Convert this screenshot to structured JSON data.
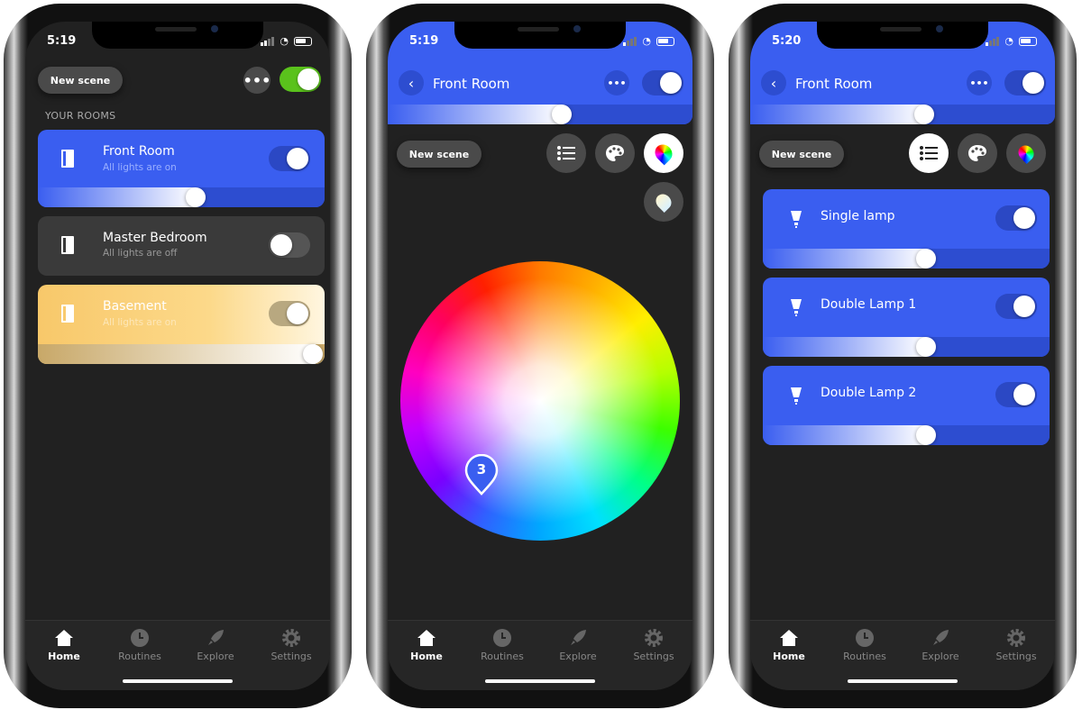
{
  "phones": [
    {
      "status": {
        "time": "5:19"
      },
      "top": {
        "new_scene": "New scene",
        "master_toggle_on": true
      },
      "section_label": "YOUR ROOMS",
      "rooms": [
        {
          "name": "Front Room",
          "status": "All lights are on",
          "on": true,
          "brightness": 0.55,
          "color": "#3a5ef0"
        },
        {
          "name": "Master Bedroom",
          "status": "All lights are off",
          "on": false,
          "color": "#3a3a3a"
        },
        {
          "name": "Basement",
          "status": "All lights are on",
          "on": true,
          "brightness": 0.97,
          "color": "#f8c86a"
        }
      ],
      "tabs": [
        "Home",
        "Routines",
        "Explore",
        "Settings"
      ],
      "active_tab": "Home"
    },
    {
      "status": {
        "time": "5:19"
      },
      "header": {
        "title": "Front Room",
        "on": true,
        "brightness": 0.58
      },
      "new_scene": "New scene",
      "view_buttons": [
        "list-view",
        "scenes-palette",
        "color-picker",
        "white-picker"
      ],
      "active_view": "color-picker",
      "color_pin_label": "3",
      "tabs": [
        "Home",
        "Routines",
        "Explore",
        "Settings"
      ],
      "active_tab": "Home"
    },
    {
      "status": {
        "time": "5:20"
      },
      "header": {
        "title": "Front Room",
        "on": true,
        "brightness": 0.58
      },
      "new_scene": "New scene",
      "view_buttons": [
        "list-view",
        "scenes-palette",
        "color-picker"
      ],
      "active_view": "list-view",
      "lights": [
        {
          "name": "Single lamp",
          "on": true,
          "brightness": 0.57
        },
        {
          "name": "Double Lamp 1",
          "on": true,
          "brightness": 0.57
        },
        {
          "name": "Double Lamp 2",
          "on": true,
          "brightness": 0.57
        }
      ],
      "tabs": [
        "Home",
        "Routines",
        "Explore",
        "Settings"
      ],
      "active_tab": "Home"
    }
  ]
}
